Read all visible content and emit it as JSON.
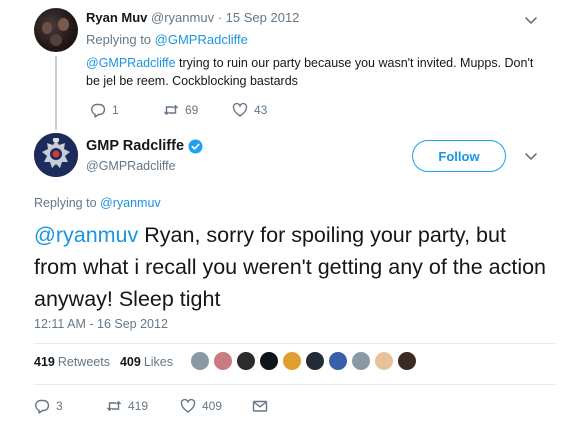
{
  "reply": {
    "name": "Ryan Muv",
    "handle": "@ryanmuv",
    "separator": "·",
    "date": "15 Sep 2012",
    "replying_to_prefix": "Replying to",
    "replying_to": "@GMPRadcliffe",
    "mention": "@GMPRadcliffe",
    "text": " trying to ruin our party because you wasn't invited. Mupps. Don't be jel be reem. Cockblocking bastards",
    "reply_count": "1",
    "retweet_count": "69",
    "like_count": "43"
  },
  "main": {
    "name": "GMP Radcliffe",
    "handle": "@GMPRadcliffe",
    "follow_label": "Follow",
    "replying_to_prefix": "Replying to",
    "replying_to": "@ryanmuv",
    "mention": "@ryanmuv",
    "text": " Ryan, sorry for spoiling your party, but from what i recall you weren't getting any of the action anyway! Sleep tight",
    "timestamp": "12:11 AM - 16 Sep 2012",
    "retweets_count": "419",
    "retweets_label": "Retweets",
    "likes_count": "409",
    "likes_label": "Likes",
    "reply_count": "3",
    "retweet_count": "419",
    "like_count": "409"
  },
  "likers": [
    {
      "icon": "default-egg-avatar",
      "color": "#8899a6"
    },
    {
      "icon": "woman-avatar",
      "color": "#c97b7e"
    },
    {
      "icon": "dark-avatar",
      "color": "#2b2b2b"
    },
    {
      "icon": "black-avatar",
      "color": "#0f1419"
    },
    {
      "icon": "colorful-avatar",
      "color": "#e0a030"
    },
    {
      "icon": "dark-avatar",
      "color": "#222b36"
    },
    {
      "icon": "badge-avatar",
      "color": "#3b5fa8"
    },
    {
      "icon": "default-egg-avatar",
      "color": "#8899a6"
    },
    {
      "icon": "blonde-avatar",
      "color": "#e8c39a"
    },
    {
      "icon": "bearded-avatar",
      "color": "#3a2a22"
    }
  ],
  "colors": {
    "link": "#1b95e0",
    "muted": "#657786",
    "text": "#14171a",
    "verified": "#1da1f2",
    "divider": "#e6ecf0"
  }
}
